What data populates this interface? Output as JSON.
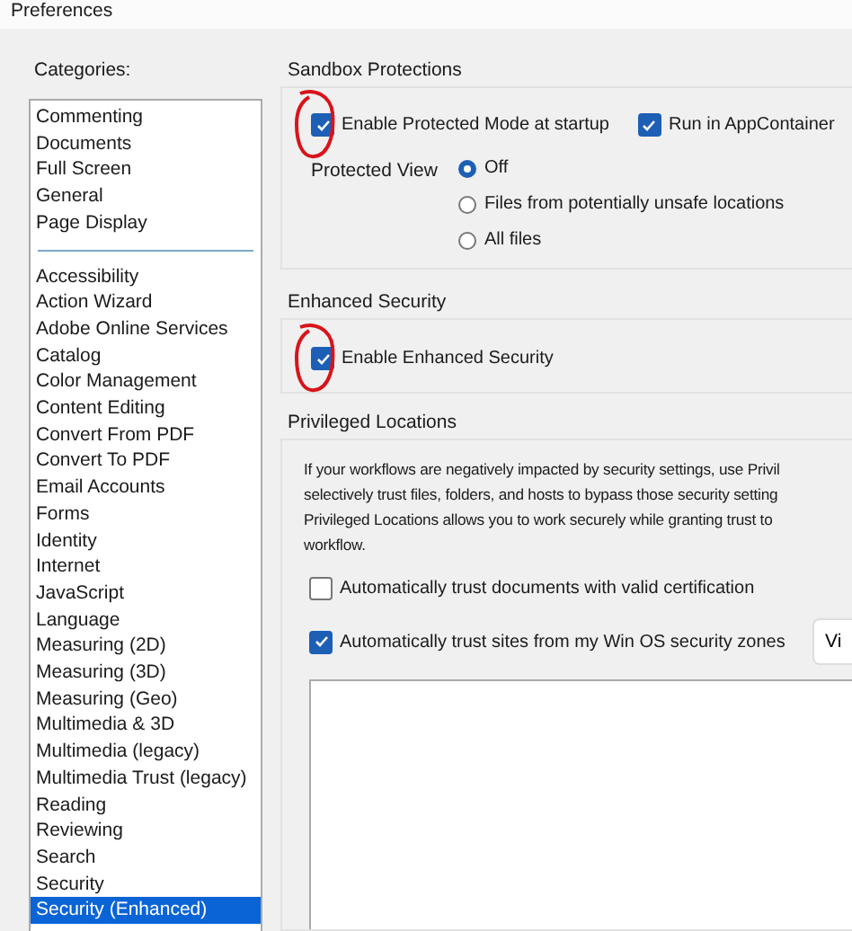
{
  "window": {
    "title": "Preferences"
  },
  "categories": {
    "label": "Categories:",
    "groups": [
      [
        {
          "label": "Commenting",
          "selected": false
        },
        {
          "label": "Documents",
          "selected": false
        },
        {
          "label": "Full Screen",
          "selected": false
        },
        {
          "label": "General",
          "selected": false
        },
        {
          "label": "Page Display",
          "selected": false
        }
      ],
      [
        {
          "label": "Accessibility",
          "selected": false
        },
        {
          "label": "Action Wizard",
          "selected": false
        },
        {
          "label": "Adobe Online Services",
          "selected": false
        },
        {
          "label": "Catalog",
          "selected": false
        },
        {
          "label": "Color Management",
          "selected": false
        },
        {
          "label": "Content Editing",
          "selected": false
        },
        {
          "label": "Convert From PDF",
          "selected": false
        },
        {
          "label": "Convert To PDF",
          "selected": false
        },
        {
          "label": "Email Accounts",
          "selected": false
        },
        {
          "label": "Forms",
          "selected": false
        },
        {
          "label": "Identity",
          "selected": false
        },
        {
          "label": "Internet",
          "selected": false
        },
        {
          "label": "JavaScript",
          "selected": false
        },
        {
          "label": "Language",
          "selected": false
        },
        {
          "label": "Measuring (2D)",
          "selected": false
        },
        {
          "label": "Measuring (3D)",
          "selected": false
        },
        {
          "label": "Measuring (Geo)",
          "selected": false
        },
        {
          "label": "Multimedia & 3D",
          "selected": false
        },
        {
          "label": "Multimedia (legacy)",
          "selected": false
        },
        {
          "label": "Multimedia Trust (legacy)",
          "selected": false
        },
        {
          "label": "Reading",
          "selected": false
        },
        {
          "label": "Reviewing",
          "selected": false
        },
        {
          "label": "Search",
          "selected": false
        },
        {
          "label": "Security",
          "selected": false
        },
        {
          "label": "Security (Enhanced)",
          "selected": true
        }
      ]
    ]
  },
  "sandbox": {
    "title": "Sandbox Protections",
    "options": [
      {
        "label": "Enable Protected Mode at startup",
        "checked": true,
        "circled": true
      },
      {
        "label": "Run in AppContainer",
        "checked": true
      }
    ],
    "protected_view": {
      "label": "Protected View",
      "choices": [
        {
          "label": "Off",
          "selected": true
        },
        {
          "label": "Files from potentially unsafe locations",
          "selected": false
        },
        {
          "label": "All files",
          "selected": false
        }
      ]
    }
  },
  "enhanced": {
    "title": "Enhanced Security",
    "option": {
      "label": "Enable Enhanced Security",
      "checked": true,
      "circled": true
    }
  },
  "privileged": {
    "title": "Privileged Locations",
    "description": [
      "If your workflows are negatively impacted by security settings, use Privil",
      "selectively trust files, folders, and hosts to bypass those security setting",
      "Privileged Locations allows you to work securely while granting trust to",
      "workflow."
    ],
    "options": [
      {
        "label": "Automatically trust documents with valid certification",
        "checked": false
      },
      {
        "label": "Automatically trust sites from my Win OS security zones",
        "checked": true
      }
    ],
    "button": "Vi"
  }
}
